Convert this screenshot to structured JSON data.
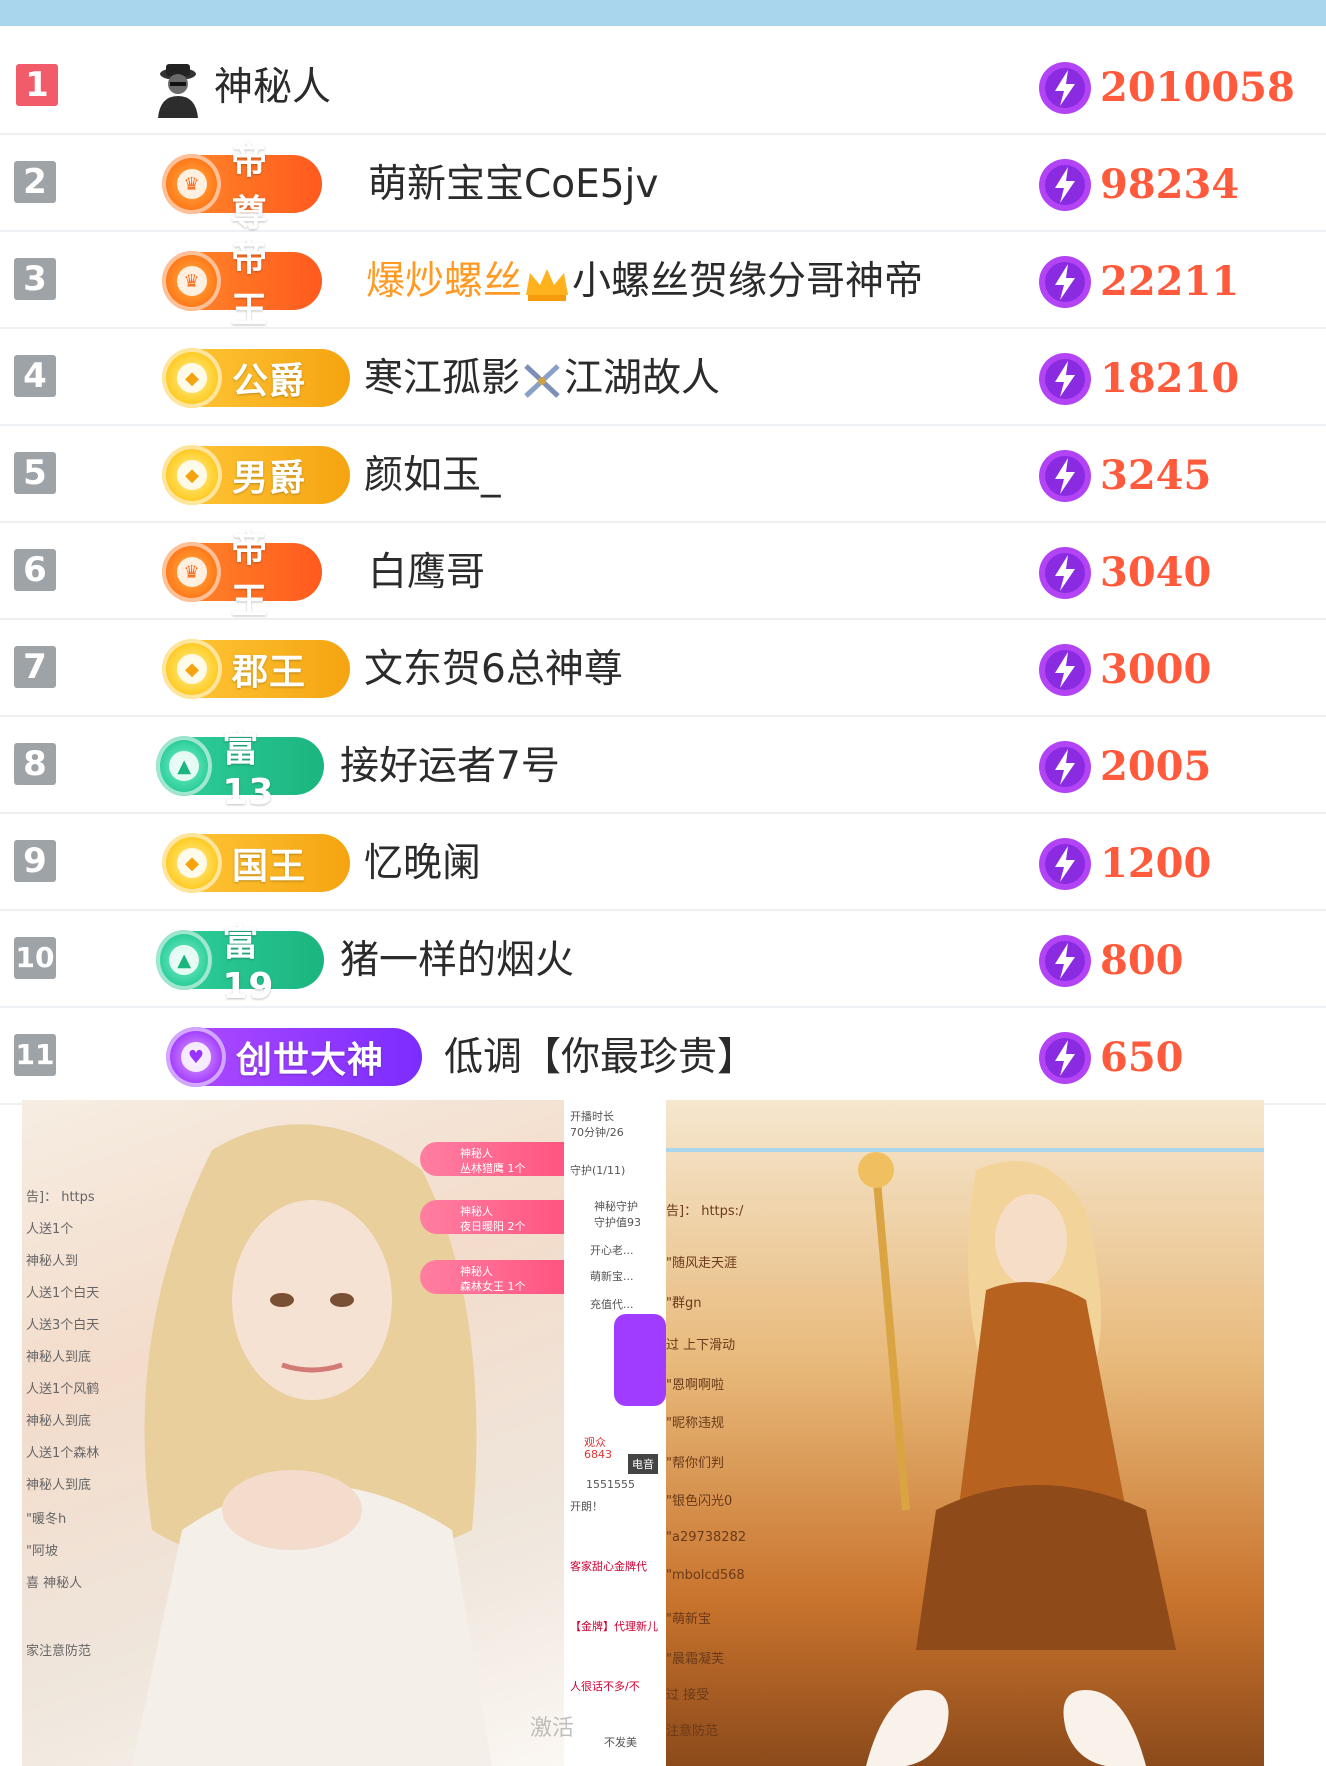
{
  "leaderboard": {
    "rows": [
      {
        "rank": "1",
        "badge": "",
        "name": "神秘人",
        "score": "2010058"
      },
      {
        "rank": "2",
        "badge": "帝尊",
        "name": "萌新宝宝CoE5jv",
        "score": "98234"
      },
      {
        "rank": "3",
        "badge": "帝王",
        "name_highlight": "爆炒螺丝",
        "name": "小螺丝贺缘分哥神帝",
        "score": "22211"
      },
      {
        "rank": "4",
        "badge": "公爵",
        "name_a": "寒江孤影",
        "name": "江湖故人",
        "score": "18210"
      },
      {
        "rank": "5",
        "badge": "男爵",
        "name": "颜如玉_",
        "score": "3245"
      },
      {
        "rank": "6",
        "badge": "帝王",
        "name": "白鹰哥",
        "score": "3040"
      },
      {
        "rank": "7",
        "badge": "郡王",
        "name": "文东贺6总神尊",
        "score": "3000"
      },
      {
        "rank": "8",
        "badge": "富13",
        "name": "接好运者7号",
        "score": "2005"
      },
      {
        "rank": "9",
        "badge": "国王",
        "name": "忆晚阑",
        "score": "1200"
      },
      {
        "rank": "10",
        "badge": "富19",
        "name": "猪一样的烟火",
        "score": "800"
      },
      {
        "rank": "11",
        "badge": "创世大神",
        "name": "低调【你最珍贵】",
        "score": "650"
      }
    ]
  },
  "left_shot": {
    "chat": [
      "告]： https",
      "人送1个",
      "神秘人到",
      "人送1个白天",
      "人送3个白天",
      "神秘人到底",
      "人送1个风鹤",
      "神秘人到底",
      "人送1个森林",
      "神秘人到底",
      "\"暖冬h",
      "\"阿坡",
      "喜 神秘人",
      "家注意防范"
    ],
    "gifts": [
      {
        "from": "神秘人",
        "item": "丛林猎鹰 1个"
      },
      {
        "from": "神秘人",
        "item": "夜日暖阳 2个"
      },
      {
        "from": "神秘人",
        "item": "森林女王 1个"
      }
    ]
  },
  "mid_shot": {
    "lines": [
      "开播时长",
      "70分钟/26",
      "守护(1/11)",
      "神秘守护",
      "守护值93",
      "开心老...",
      "萌新宝...",
      "充值代...",
      "观众",
      "6843",
      "电音",
      "1551555",
      "开朗！",
      "客家甜心金牌代",
      "【金牌】代理新儿",
      "人很话不多/不",
      "不发美"
    ]
  },
  "right_shot": {
    "lines": [
      "告]： https:/",
      "\"随风走天涯",
      "\"群gn",
      "过 上下滑动",
      "\"恩啊啊啦",
      "\"昵称违规",
      "\"帮你们判",
      "\"银色闪光0",
      "\"a29738282",
      "\"mbolcd568",
      "\"萌新宝",
      "\"晨霜凝芙",
      "过 接受",
      "注意防范"
    ],
    "watermark": "激活"
  },
  "colors": {
    "score": "#ff5a3c",
    "rank_first": "#f25c6a",
    "rank_other": "#9ea3a8",
    "top_bar": "#a9d6ec"
  }
}
